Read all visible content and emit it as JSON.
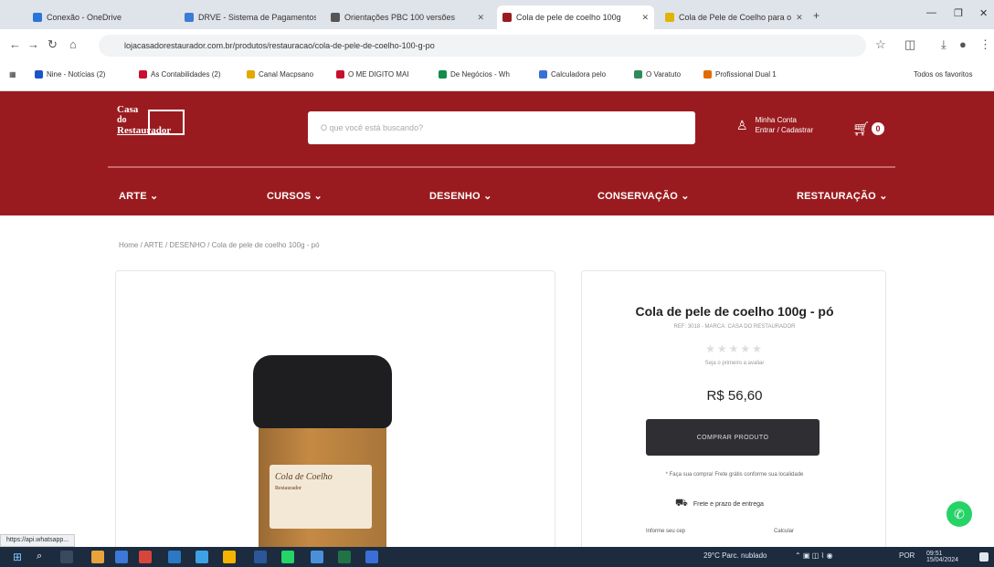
{
  "browser": {
    "tabs": [
      {
        "label": "Conexão - OneDrive",
        "color": "#2b74d9",
        "active": false
      },
      {
        "label": "DRVE - Sistema de Pagamentos",
        "color": "#3c7bd6",
        "active": false
      },
      {
        "label": "Orientações PBC 100 versões",
        "color": "#555555",
        "active": false
      },
      {
        "label": "Cola de pele de coelho 100g",
        "color": "#9a1b1f",
        "active": true
      },
      {
        "label": "Cola de Pele de Coelho para o",
        "color": "#e0b400",
        "active": false
      }
    ],
    "url": "lojacasadorestaurador.com.br/produtos/restauracao/cola-de-pele-de-coelho-100-g-po",
    "bookmarks": [
      {
        "label": "Nine - Notícias (2)",
        "color": "#1a55c8"
      },
      {
        "label": "As Contabilidades (2)",
        "color": "#c8102e"
      },
      {
        "label": "Canal Macpsano",
        "color": "#e3a900"
      },
      {
        "label": "O ME DIGITO MAI",
        "color": "#c8102e"
      },
      {
        "label": "De Negócios - Wh",
        "color": "#128c4a"
      },
      {
        "label": "Calculadora pelo",
        "color": "#3a6fd8"
      },
      {
        "label": "O Varatuto",
        "color": "#2e8b57"
      },
      {
        "label": "Profissional Dual 1",
        "color": "#e06b00"
      }
    ],
    "other_bookmarks": "Todos os favoritos"
  },
  "site": {
    "logo": {
      "line1": "Casa",
      "line2": "do",
      "line3": "Restaurador"
    },
    "search_placeholder": "O que você está buscando?",
    "account": {
      "line1": "Minha Conta",
      "line2": "Entrar / Cadastrar"
    },
    "cart_count": "0",
    "menu": [
      "ARTE",
      "CURSOS",
      "DESENHO",
      "CONSERVAÇÃO",
      "RESTAURAÇÃO"
    ],
    "breadcrumb": "Home / ARTE / DESENHO / Cola de pele de coelho 100g - pó"
  },
  "product": {
    "image_label_title": "Cola de Coelho",
    "image_label_sub": "Restaurador",
    "title": "Cola de pele de coelho 100g - pó",
    "subtitle": "REF: 3018 - MARCA: CASA DO RESTAURADOR",
    "stars": "★★★★★",
    "reviews": "Seja o primeiro a avaliar",
    "price": "R$ 56,60",
    "buy_label": "COMPRAR PRODUTO",
    "note": "* Faça sua compra! Frete grátis conforme sua localidade",
    "shipping_label": "Frete e prazo de entrega",
    "cep_label": "Informe seu cep",
    "cep_action": "Calcular"
  },
  "status_url": "https://api.whatsapp...",
  "taskbar": {
    "weather": "29°C Parc. nublado",
    "time": "09:51",
    "date": "15/04/2024",
    "lang": "POR"
  }
}
